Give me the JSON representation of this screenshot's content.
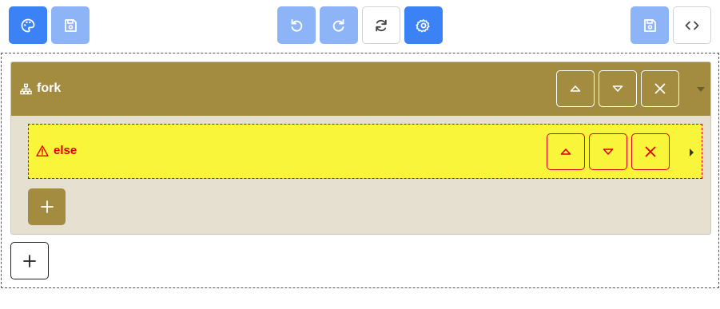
{
  "toolbar": {
    "buttons": [
      {
        "name": "theme-button",
        "icon": "palette-icon",
        "style": "primary"
      },
      {
        "name": "save-button",
        "icon": "save-icon",
        "style": "light"
      },
      {
        "name": "undo-button",
        "icon": "undo-icon",
        "style": "light"
      },
      {
        "name": "redo-button",
        "icon": "redo-icon",
        "style": "light"
      },
      {
        "name": "refresh-button",
        "icon": "refresh-icon",
        "style": "outline"
      },
      {
        "name": "settings-button",
        "icon": "gear-icon",
        "style": "primary"
      },
      {
        "name": "save-right-button",
        "icon": "save-icon",
        "style": "light"
      },
      {
        "name": "code-button",
        "icon": "code-icon",
        "style": "outline"
      }
    ]
  },
  "fork": {
    "title": "fork",
    "icon": "sitemap-icon",
    "accent": "#a38c3f",
    "actions": [
      "move-up-icon",
      "move-down-icon",
      "close-icon"
    ],
    "else_block": {
      "title": "else",
      "icon": "warning-icon",
      "color": "#e00000",
      "background": "#f9f53b",
      "actions": [
        "move-up-icon",
        "move-down-icon",
        "close-icon"
      ]
    },
    "add_icon": "plus-icon"
  },
  "root_add_icon": "plus-icon"
}
